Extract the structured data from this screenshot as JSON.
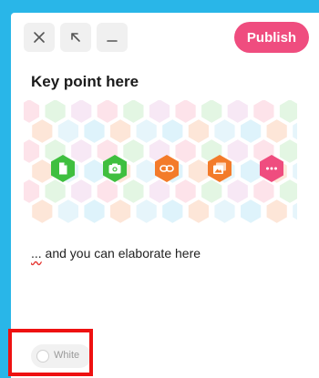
{
  "toolbar": {
    "close_icon": "close-icon",
    "expand_icon": "arrow-up-left-icon",
    "minimize_icon": "minimize-icon",
    "publish_label": "Publish"
  },
  "post": {
    "title": "Key point here",
    "body_squiggle": "...",
    "body_text": " and you can elaborate here"
  },
  "media_buttons": [
    {
      "name": "document-icon",
      "color": "#3fbf3f"
    },
    {
      "name": "camera-icon",
      "color": "#3fbf3f"
    },
    {
      "name": "link-icon",
      "color": "#f37b2a"
    },
    {
      "name": "photos-icon",
      "color": "#f37b2a"
    },
    {
      "name": "more-icon",
      "color": "#ef4d7f"
    }
  ],
  "background_toggle": {
    "label": "White"
  },
  "colors": {
    "frame": "#29b6e8",
    "publish": "#ef4d7f",
    "green": "#3fbf3f",
    "orange": "#f37b2a",
    "pink": "#ef4d7f",
    "highlight": "#ee1111"
  }
}
